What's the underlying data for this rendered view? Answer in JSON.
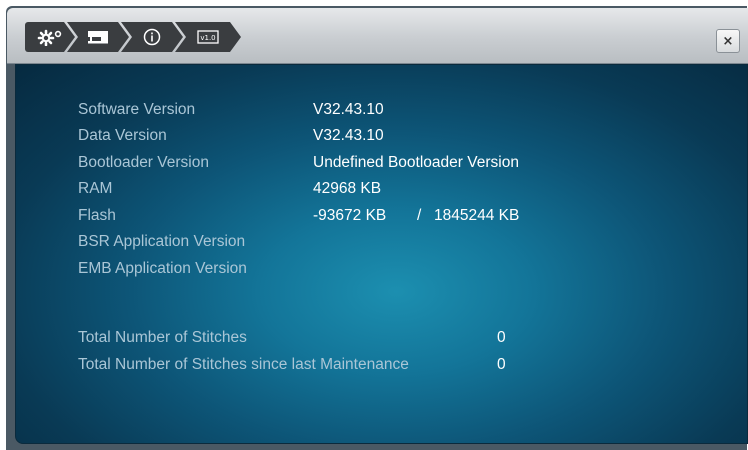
{
  "toolbar": {
    "crumbs": [
      {
        "icon": "gear-icon"
      },
      {
        "icon": "machine-icon"
      },
      {
        "icon": "info-icon"
      },
      {
        "icon": "version-icon",
        "label": "v1.0"
      }
    ],
    "close_label": "×"
  },
  "info": {
    "software_version": {
      "label": "Software Version",
      "value": "V32.43.10"
    },
    "data_version": {
      "label": "Data Version",
      "value": "V32.43.10"
    },
    "bootloader_version": {
      "label": "Bootloader Version",
      "value": "Undefined Bootloader Version"
    },
    "ram": {
      "label": "RAM",
      "value": "42968 KB"
    },
    "flash": {
      "label": "Flash",
      "value": "-93672 KB",
      "separator": "/",
      "total": "1845244 KB"
    },
    "bsr_version": {
      "label": "BSR Application Version",
      "value": ""
    },
    "emb_version": {
      "label": "EMB Application Version",
      "value": ""
    }
  },
  "stitches": {
    "total": {
      "label": "Total Number of Stitches",
      "value": "0"
    },
    "since_maintenance": {
      "label": "Total Number of Stitches since last Maintenance",
      "value": "0"
    }
  },
  "colors": {
    "panel_center": "#1c8fb0",
    "panel_edge": "#062a40",
    "label_text": "#aac6d6",
    "value_text": "#ffffff",
    "crumb_bg": "#3a3d40"
  }
}
